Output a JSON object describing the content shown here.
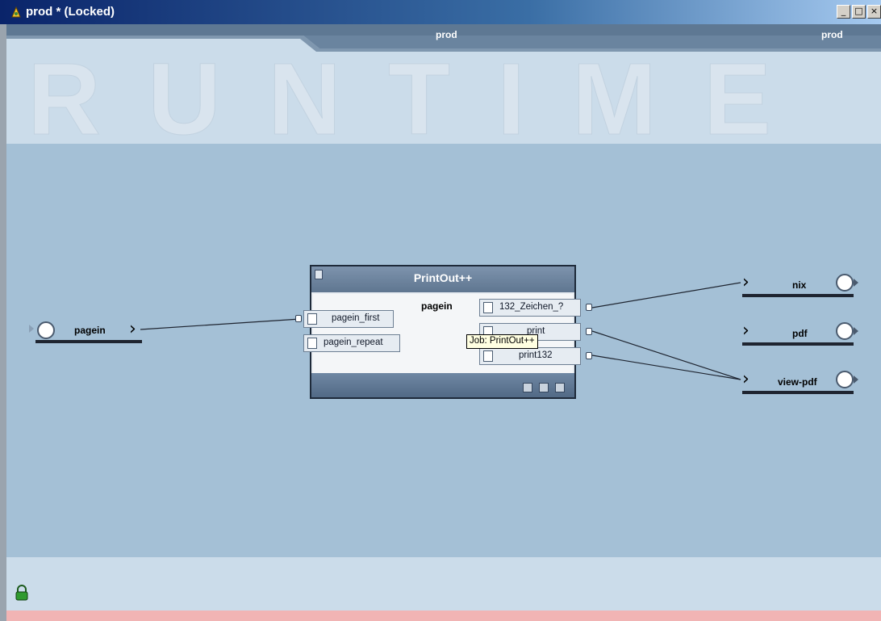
{
  "window": {
    "title": "prod * (Locked)",
    "controls": [
      "_",
      "□",
      "×"
    ]
  },
  "header": {
    "tab_center": "prod",
    "tab_right": "prod",
    "watermark": "RUNTIME"
  },
  "source": {
    "label": "pagein"
  },
  "job": {
    "title": "PrintOut++",
    "center_label": "pagein",
    "inputs": [
      {
        "label": "pagein_first"
      },
      {
        "label": "pagein_repeat"
      }
    ],
    "outputs": [
      {
        "label": "132_Zeichen_?"
      },
      {
        "label": "print"
      },
      {
        "label": "print132"
      }
    ]
  },
  "tooltip": "Job: PrintOut++",
  "targets": [
    {
      "label": "nix"
    },
    {
      "label": "pdf"
    },
    {
      "label": "view-pdf"
    }
  ],
  "colors": {
    "canvas": "#a4c0d6",
    "header": "#cbdcea",
    "status_strip": "#f1b4b4",
    "titlebar": "#0a246a"
  },
  "icons": [
    "app-icon",
    "document-icon",
    "printer-icon",
    "lock-icon",
    "port-circle-icon"
  ]
}
